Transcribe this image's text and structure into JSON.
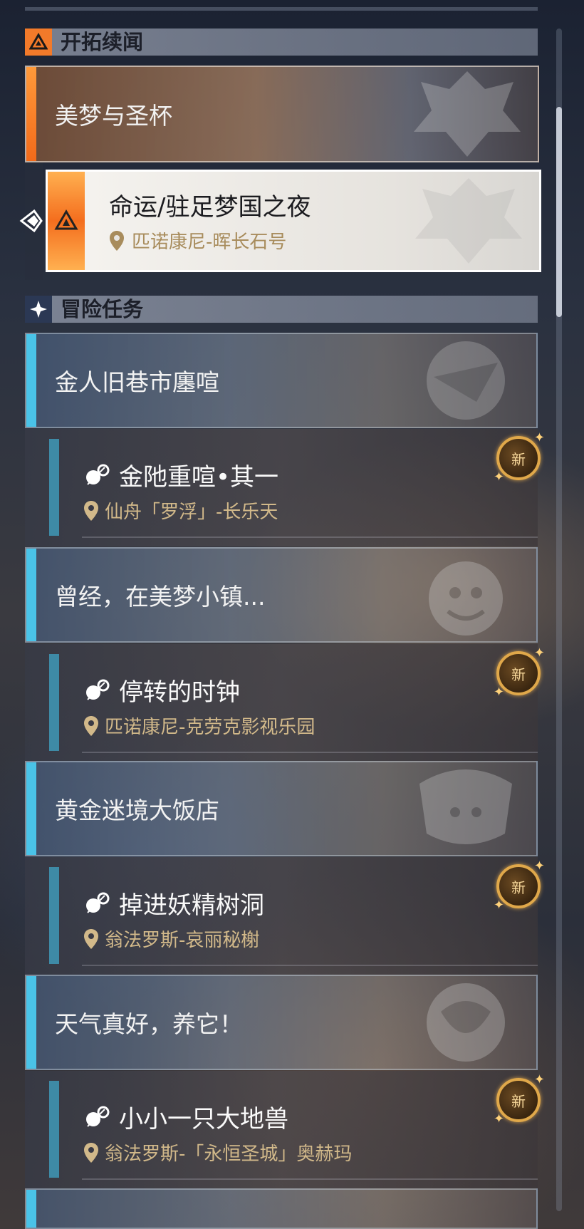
{
  "sections": {
    "trailblaze": {
      "title": "开拓续闻"
    },
    "adventure": {
      "title": "冒险任务"
    }
  },
  "trailblaze_mission": {
    "header": "美梦与圣杯",
    "selected_quest": {
      "title": "命运/驻足梦国之夜",
      "location": "匹诺康尼-晖长石号"
    }
  },
  "adventure_groups": [
    {
      "header": "金人旧巷市廛喧",
      "quest": {
        "title": "金阤重喧•其一",
        "location": "仙舟「罗浮」-长乐天",
        "badge": "新"
      }
    },
    {
      "header": "曾经，在美梦小镇...",
      "quest": {
        "title": "停转的时钟",
        "location": "匹诺康尼-克劳克影视乐园",
        "badge": "新"
      }
    },
    {
      "header": "黄金迷境大饭店",
      "quest": {
        "title": "掉进妖精树洞",
        "location": "翁法罗斯-哀丽秘榭",
        "badge": "新"
      }
    },
    {
      "header": "天气真好，养它！",
      "quest": {
        "title": "小小一只大地兽",
        "location": "翁法罗斯-「永恒圣城」奥赫玛",
        "badge": "新"
      }
    }
  ],
  "icons": {
    "trailblaze_section": "trailblaze-triangle-icon",
    "adventure_section": "four-point-star-icon",
    "location": "location-pin-icon",
    "quest_type": "adventure-quest-icon",
    "selected_pointer": "selection-arrow-icon"
  },
  "colors": {
    "trailblaze_accent": "#f27a2a",
    "adventure_accent": "#4ac3e8",
    "location_text": "#d2b98a"
  }
}
